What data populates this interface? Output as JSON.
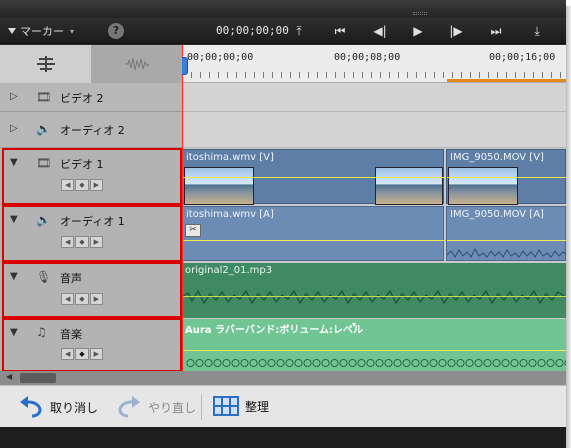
{
  "toolbar": {
    "marker_label": "マーカー",
    "help_label": "?",
    "timecode": "00;00;00;00"
  },
  "ruler": {
    "labels": [
      "00;00;00;00",
      "00;00;08;00",
      "00;00;16;00"
    ]
  },
  "tracks": [
    {
      "name": "ビデオ 2",
      "icon": "film-icon",
      "expanded": false
    },
    {
      "name": "オーディオ 2",
      "icon": "speaker-icon",
      "expanded": false
    },
    {
      "name": "ビデオ 1",
      "icon": "film-icon",
      "expanded": true
    },
    {
      "name": "オーディオ 1",
      "icon": "speaker-icon",
      "expanded": true
    },
    {
      "name": "音声",
      "icon": "microphone-icon",
      "expanded": true
    },
    {
      "name": "音楽",
      "icon": "music-note-icon",
      "expanded": true
    }
  ],
  "clips": {
    "video1_a": "itoshima.wmv [V]",
    "video1_b": "IMG_9050.MOV [V]",
    "audio1_a": "itoshima.wmv [A]",
    "audio1_b": "IMG_9050.MOV [A]",
    "narration": "original2_01.mp3",
    "music": "Aura ラバーバンド:ボリューム:レベル"
  },
  "bottom": {
    "undo_label": "取り消し",
    "redo_label": "やり直し",
    "organize_label": "整理"
  },
  "colors": {
    "highlight_box": "#d90000",
    "playhead": "#ff2a2a",
    "video_clip": "#5f7ea6",
    "narration_clip": "#3f8a63",
    "music_clip": "#70c592"
  }
}
